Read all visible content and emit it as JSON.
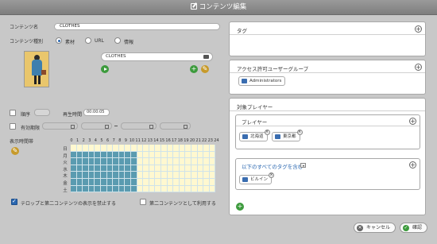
{
  "window": {
    "title": "コンテンツ編集"
  },
  "content_name": {
    "label": "コンテンツ名",
    "value": "CLOTHES"
  },
  "content_type": {
    "label": "コンテンツ種別",
    "options": [
      "素材",
      "URL",
      "情報"
    ],
    "selected": "素材"
  },
  "file": {
    "name": "CLOTHES"
  },
  "order": {
    "label": "順序"
  },
  "playback_time": {
    "label": "再生時間",
    "value": "00:00:05"
  },
  "validity": {
    "label": "有効期限"
  },
  "schedule": {
    "label": "表示時間帯",
    "hours": [
      "0",
      "1",
      "2",
      "3",
      "4",
      "5",
      "6",
      "7",
      "8",
      "9",
      "10",
      "11",
      "12",
      "13",
      "14",
      "15",
      "16",
      "17",
      "18",
      "19",
      "20",
      "21",
      "22",
      "23",
      "24"
    ],
    "days": [
      "日",
      "月",
      "火",
      "水",
      "木",
      "金",
      "土"
    ]
  },
  "options": {
    "telop_disable": {
      "label": "テロップと第二コンテンツの表示を禁止する",
      "checked": true
    },
    "as_second": {
      "label": "第二コンテンツとして利用する",
      "checked": false
    }
  },
  "tags_panel": {
    "title": "タグ"
  },
  "access_panel": {
    "title": "アクセス許可ユーザーグループ",
    "chips": [
      "Administrators"
    ]
  },
  "target_players": {
    "title": "対象プレイヤー",
    "players_label": "プレイヤー",
    "players": [
      "北海道",
      "東京都"
    ],
    "tag_filter_label": "以下のすべてのタグを含む",
    "tags": [
      "ビルイン"
    ]
  },
  "footer": {
    "cancel_label": "キャンセル",
    "confirm_label": "確認"
  },
  "colors": {
    "selected_cell": "#5a9bb0",
    "unselected_cell": "#fff8d0",
    "accent": "#2a67b0"
  }
}
